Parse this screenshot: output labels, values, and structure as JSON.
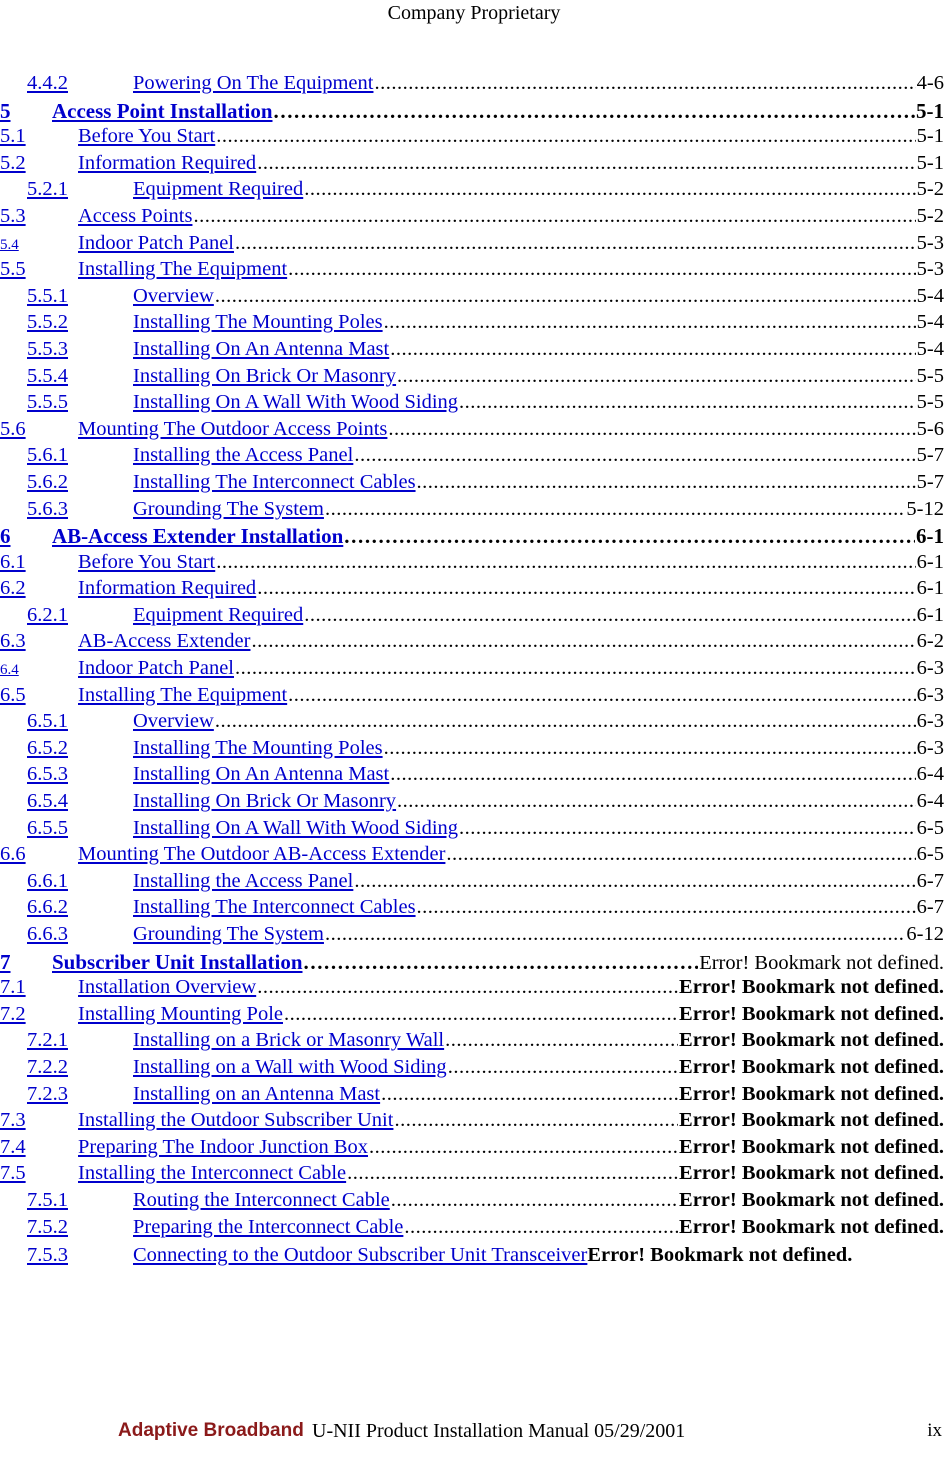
{
  "header": {
    "text": "Company Proprietary"
  },
  "toc": {
    "entries": [
      {
        "level": 3,
        "number": "4.4.2",
        "title": "Powering On The Equipment",
        "page": "4-6",
        "page_style": "normal"
      },
      {
        "level": 1,
        "number": "5",
        "title": "Access Point Installation",
        "page": "5-1",
        "page_style": "normal"
      },
      {
        "level": 2,
        "number": "5.1",
        "title": "Before You Start",
        "page": "5-1",
        "page_style": "normal"
      },
      {
        "level": 2,
        "number": "5.2",
        "title": "Information Required",
        "page": "5-1",
        "page_style": "normal"
      },
      {
        "level": 3,
        "number": "5.2.1",
        "title": "Equipment Required",
        "page": "5-2",
        "page_style": "normal"
      },
      {
        "level": 2,
        "number": "5.3",
        "title": "Access Points",
        "page": "5-2",
        "page_style": "normal"
      },
      {
        "level": 2,
        "number": "5.4",
        "title": "Indoor Patch Panel",
        "page": "5-3",
        "page_style": "normal",
        "small_number": true
      },
      {
        "level": 2,
        "number": "5.5",
        "title": "Installing The Equipment",
        "page": "5-3",
        "page_style": "normal"
      },
      {
        "level": 3,
        "number": "5.5.1",
        "title": "Overview",
        "page": "5-4",
        "page_style": "normal"
      },
      {
        "level": 3,
        "number": "5.5.2",
        "title": "Installing The Mounting Poles",
        "page": "5-4",
        "page_style": "normal"
      },
      {
        "level": 3,
        "number": "5.5.3",
        "title": "Installing On An Antenna Mast",
        "page": "5-4",
        "page_style": "normal"
      },
      {
        "level": 3,
        "number": "5.5.4",
        "title": "Installing On Brick Or Masonry",
        "page": "5-5",
        "page_style": "normal"
      },
      {
        "level": 3,
        "number": "5.5.5",
        "title": "Installing On A Wall With Wood Siding",
        "page": "5-5",
        "page_style": "normal"
      },
      {
        "level": 2,
        "number": "5.6",
        "title": "Mounting The Outdoor Access Points",
        "page": "5-6",
        "page_style": "normal"
      },
      {
        "level": 3,
        "number": "5.6.1",
        "title": "Installing the Access Panel",
        "page": "5-7",
        "page_style": "normal"
      },
      {
        "level": 3,
        "number": "5.6.2",
        "title": "Installing The Interconnect Cables",
        "page": "5-7",
        "page_style": "normal"
      },
      {
        "level": 3,
        "number": "5.6.3",
        "title": "Grounding The System",
        "page": "5-12",
        "page_style": "normal"
      },
      {
        "level": 1,
        "number": "6",
        "title": "AB-Access Extender Installation",
        "page": "6-1",
        "page_style": "normal"
      },
      {
        "level": 2,
        "number": "6.1",
        "title": "Before You Start",
        "page": "6-1",
        "page_style": "normal"
      },
      {
        "level": 2,
        "number": "6.2",
        "title": "Information Required",
        "page": "6-1",
        "page_style": "normal"
      },
      {
        "level": 3,
        "number": "6.2.1",
        "title": "Equipment Required",
        "page": "6-1",
        "page_style": "normal"
      },
      {
        "level": 2,
        "number": "6.3",
        "title": "AB-Access Extender",
        "page": "6-2",
        "page_style": "normal"
      },
      {
        "level": 2,
        "number": "6.4",
        "title": "Indoor Patch Panel",
        "page": "6-3",
        "page_style": "normal",
        "small_number": true
      },
      {
        "level": 2,
        "number": "6.5",
        "title": "Installing The Equipment",
        "page": "6-3",
        "page_style": "normal"
      },
      {
        "level": 3,
        "number": "6.5.1",
        "title": "Overview",
        "page": "6-3",
        "page_style": "normal"
      },
      {
        "level": 3,
        "number": "6.5.2",
        "title": "Installing The Mounting Poles",
        "page": "6-3",
        "page_style": "normal"
      },
      {
        "level": 3,
        "number": "6.5.3",
        "title": "Installing On An Antenna Mast",
        "page": "6-4",
        "page_style": "normal"
      },
      {
        "level": 3,
        "number": "6.5.4",
        "title": "Installing On Brick Or Masonry",
        "page": "6-4",
        "page_style": "normal"
      },
      {
        "level": 3,
        "number": "6.5.5",
        "title": "Installing On A Wall With Wood Siding",
        "page": "6-5",
        "page_style": "normal"
      },
      {
        "level": 2,
        "number": "6.6",
        "title": "Mounting The Outdoor AB-Access Extender",
        "page": "6-5",
        "page_style": "normal"
      },
      {
        "level": 3,
        "number": "6.6.1",
        "title": "Installing the Access Panel",
        "page": "6-7",
        "page_style": "normal"
      },
      {
        "level": 3,
        "number": "6.6.2",
        "title": "Installing The Interconnect Cables",
        "page": "6-7",
        "page_style": "normal"
      },
      {
        "level": 3,
        "number": "6.6.3",
        "title": "Grounding The System",
        "page": "6-12",
        "page_style": "normal"
      },
      {
        "level": 1,
        "number": "7",
        "title": "Subscriber Unit Installation",
        "page": "Error! Bookmark not defined.",
        "page_style": "error-plain"
      },
      {
        "level": 2,
        "number": "7.1",
        "title": "Installation Overview",
        "page": "Error! Bookmark not defined.",
        "page_style": "error"
      },
      {
        "level": 2,
        "number": "7.2",
        "title": "Installing  Mounting Pole",
        "page": "Error! Bookmark not defined.",
        "page_style": "error"
      },
      {
        "level": 3,
        "number": "7.2.1",
        "title": "Installing on a Brick or Masonry Wall",
        "page": "Error! Bookmark not defined.",
        "page_style": "error"
      },
      {
        "level": 3,
        "number": "7.2.2",
        "title": "Installing on a Wall with Wood Siding",
        "page": "Error! Bookmark not defined.",
        "page_style": "error"
      },
      {
        "level": 3,
        "number": "7.2.3",
        "title": "Installing on an Antenna Mast",
        "page": "Error! Bookmark not defined.",
        "page_style": "error"
      },
      {
        "level": 2,
        "number": "7.3",
        "title": "Installing the Outdoor Subscriber Unit",
        "page": "Error! Bookmark not defined.",
        "page_style": "error"
      },
      {
        "level": 2,
        "number": "7.4",
        "title": "Preparing The Indoor Junction Box",
        "page": "Error! Bookmark not defined.",
        "page_style": "error"
      },
      {
        "level": 2,
        "number": "7.5",
        "title": "Installing the Interconnect Cable",
        "page": "Error! Bookmark not defined.",
        "page_style": "error"
      },
      {
        "level": 3,
        "number": "7.5.1",
        "title": "Routing the Interconnect Cable",
        "page": "Error! Bookmark not defined.",
        "page_style": "error"
      },
      {
        "level": 3,
        "number": "7.5.2",
        "title": "Preparing the Interconnect Cable",
        "page": "Error! Bookmark not defined.",
        "page_style": "error"
      },
      {
        "level": 3,
        "number": "7.5.3",
        "title": "Connecting to the Outdoor Subscriber Unit Transceiver",
        "page": "Error! Bookmark not defined.",
        "page_style": "error",
        "no_leader": true,
        "wrapped": true
      }
    ]
  },
  "footer": {
    "brand": "Adaptive Broadband",
    "title": "U-NII Product Installation Manual  05/29/2001",
    "folio": "ix"
  }
}
